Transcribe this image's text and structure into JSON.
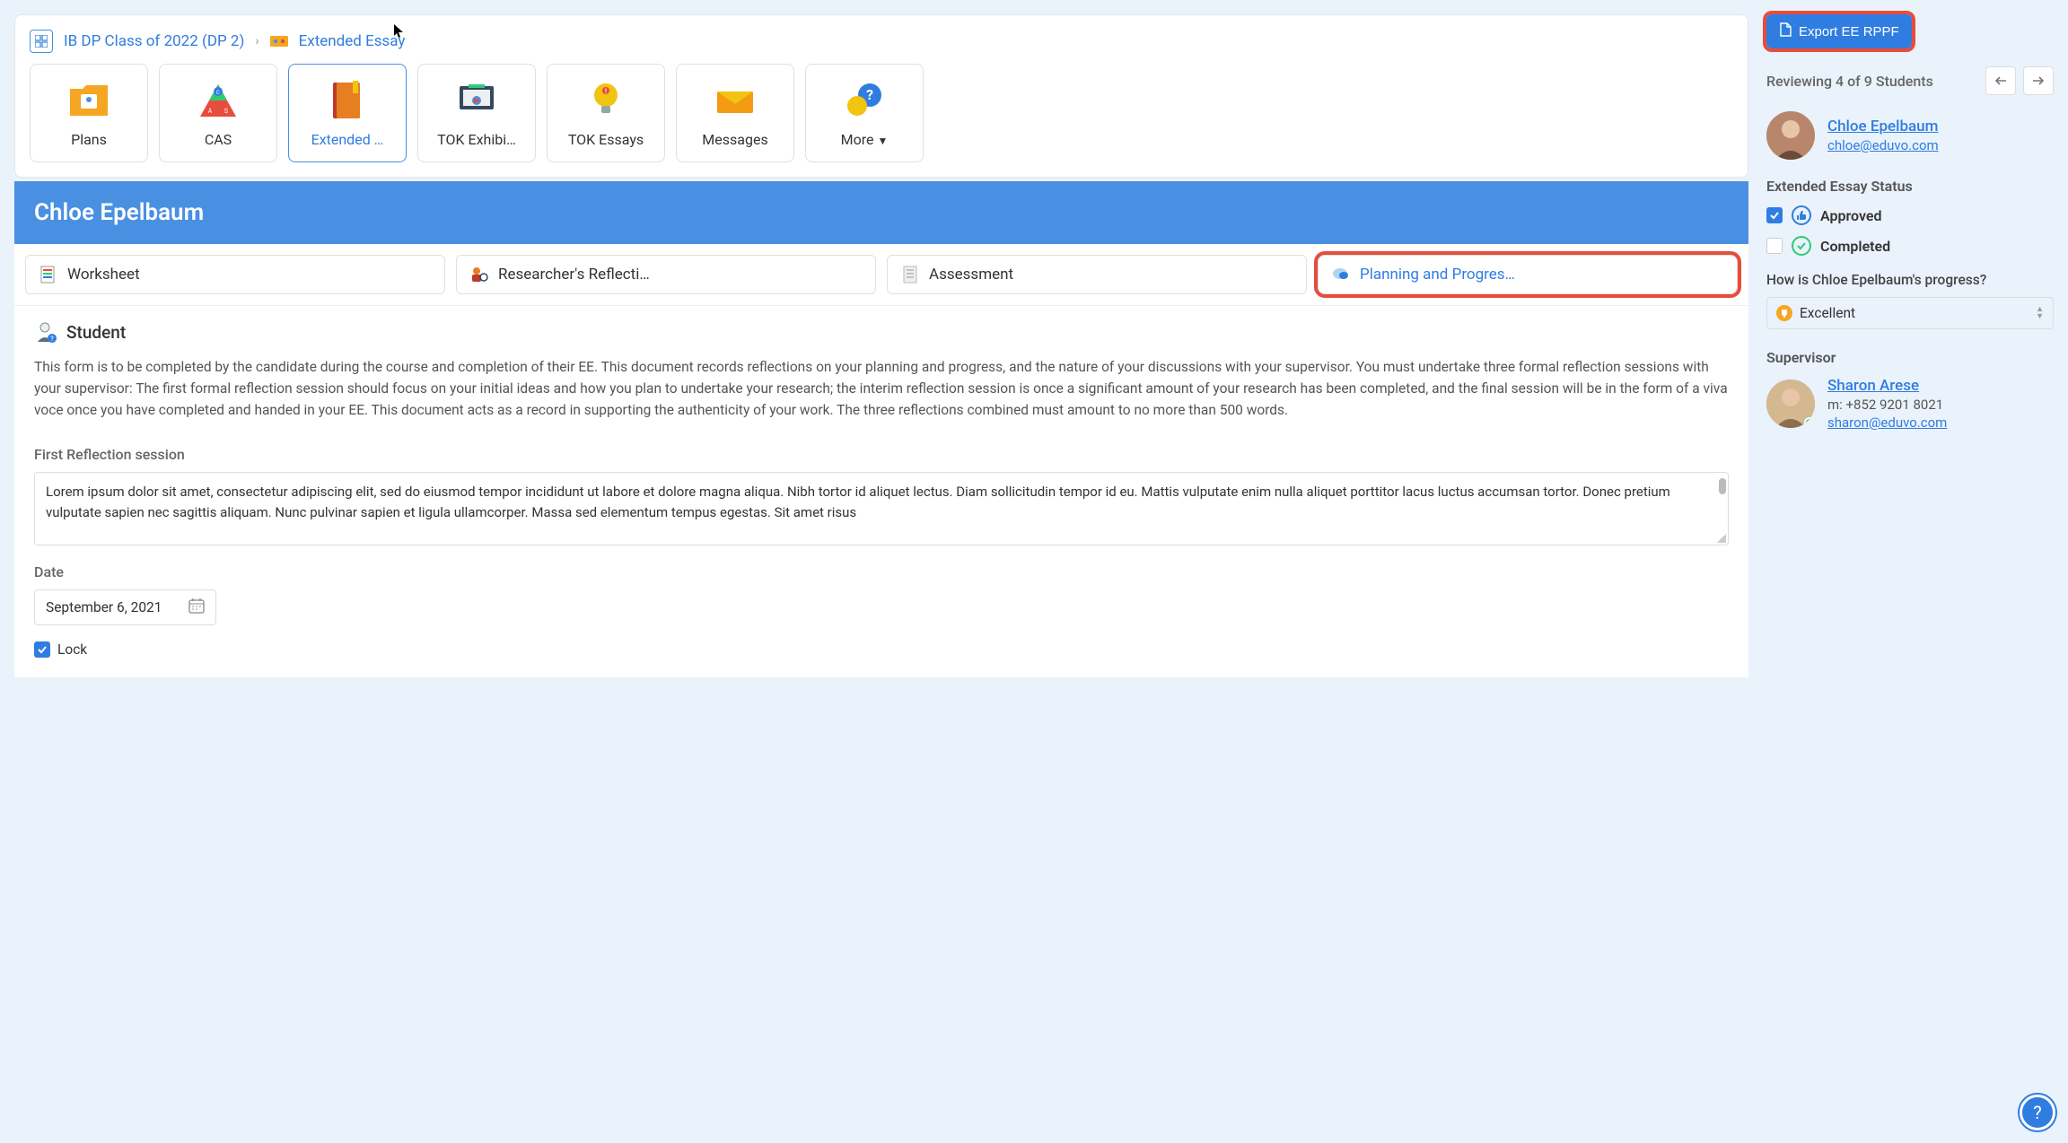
{
  "breadcrumb": {
    "class_label": "IB DP Class of 2022 (DP 2)",
    "page_label": "Extended Essay"
  },
  "nav_cards": [
    {
      "label": "Plans"
    },
    {
      "label": "CAS"
    },
    {
      "label": "Extended …"
    },
    {
      "label": "TOK Exhibi…"
    },
    {
      "label": "TOK Essays"
    },
    {
      "label": "Messages"
    },
    {
      "label": "More"
    }
  ],
  "student_header": "Chloe Epelbaum",
  "tabs": [
    {
      "label": "Worksheet"
    },
    {
      "label": "Researcher's Reflecti…"
    },
    {
      "label": "Assessment"
    },
    {
      "label": "Planning and Progres…"
    }
  ],
  "section": {
    "title": "Student",
    "description": "This form is to be completed by the candidate during the course and completion of their EE. This document records reflections on your planning and progress, and the nature of your discussions with your supervisor. You must undertake three formal reflection sessions with your supervisor: The first formal reflection session should focus on your initial ideas and how you plan to undertake your research; the interim reflection session is once a significant amount of your research has been completed, and the final session will be in the form of a viva voce once you have completed and handed in your EE. This document acts as a record in supporting the authenticity of your work. The three reflections combined must amount to no more than 500 words."
  },
  "reflection": {
    "label": "First Reflection session",
    "text": "Lorem ipsum dolor sit amet, consectetur adipiscing elit, sed do eiusmod tempor incididunt ut labore et dolore magna aliqua. Nibh tortor id aliquet lectus. Diam sollicitudin tempor id eu. Mattis vulputate enim nulla aliquet porttitor lacus luctus accumsan tortor. Donec pretium vulputate sapien nec sagittis aliquam. Nunc pulvinar sapien et ligula ullamcorper. Massa sed elementum tempus egestas. Sit amet risus"
  },
  "date": {
    "label": "Date",
    "value": "September 6, 2021"
  },
  "lock_label": "Lock",
  "side": {
    "export_label": "Export EE RPPF",
    "review_text": "Reviewing 4 of 9 Students",
    "student": {
      "name": "Chloe Epelbaum",
      "email": "chloe@eduvo.com"
    },
    "status_heading": "Extended Essay Status",
    "status_approved": "Approved",
    "status_completed": "Completed",
    "progress_question": "How is Chloe Epelbaum's progress?",
    "progress_value": "Excellent",
    "supervisor_heading": "Supervisor",
    "supervisor": {
      "name": "Sharon Arese",
      "phone": "m: +852 9201 8021",
      "email": "sharon@eduvo.com"
    }
  }
}
